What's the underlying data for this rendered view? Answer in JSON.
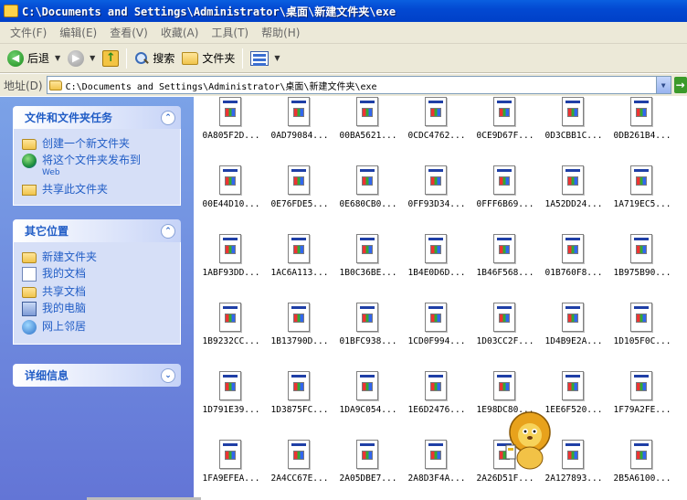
{
  "window": {
    "title": "C:\\Documents and Settings\\Administrator\\桌面\\新建文件夹\\exe"
  },
  "menu": [
    "文件(F)",
    "编辑(E)",
    "查看(V)",
    "收藏(A)",
    "工具(T)",
    "帮助(H)"
  ],
  "toolbar": {
    "back_label": "后退",
    "search_label": "搜索",
    "folders_label": "文件夹"
  },
  "address": {
    "label": "地址(D)",
    "value": "C:\\Documents and Settings\\Administrator\\桌面\\新建文件夹\\exe"
  },
  "tasks_panel": {
    "title": "文件和文件夹任务",
    "items": [
      "创建一个新文件夹",
      "将这个文件夹发布到",
      "共享此文件夹"
    ],
    "publish_sub": "Web"
  },
  "other_places": {
    "title": "其它位置",
    "items": [
      "新建文件夹",
      "我的文档",
      "共享文档",
      "我的电脑",
      "网上邻居"
    ]
  },
  "details_panel": {
    "title": "详细信息"
  },
  "files": [
    "0A805F2D...",
    "0AD79084...",
    "00BA5621...",
    "0CDC4762...",
    "0CE9D67F...",
    "0D3CBB1C...",
    "0DB261B4...",
    "00E44D10...",
    "0E76FDE5...",
    "0E680CB0...",
    "0FF93D34...",
    "0FFF6B69...",
    "1A52DD24...",
    "1A719EC5...",
    "1ABF93DD...",
    "1AC6A113...",
    "1B0C36BE...",
    "1B4E0D6D...",
    "1B46F568...",
    "01B760F8...",
    "1B975B90...",
    "1B9232CC...",
    "1B13790D...",
    "01BFC938...",
    "1CD0F994...",
    "1D03CC2F...",
    "1D4B9E2A...",
    "1D105F0C...",
    "1D791E39...",
    "1D3875FC...",
    "1DA9C054...",
    "1E6D2476...",
    "1E98DC80...",
    "1EE6F520...",
    "1F79A2FE...",
    "1FA9EFEA...",
    "2A4CC67E...",
    "2A05DBE7...",
    "2A8D3F4A...",
    "2A26D51F...",
    "2A127893...",
    "2B5A6100..."
  ]
}
